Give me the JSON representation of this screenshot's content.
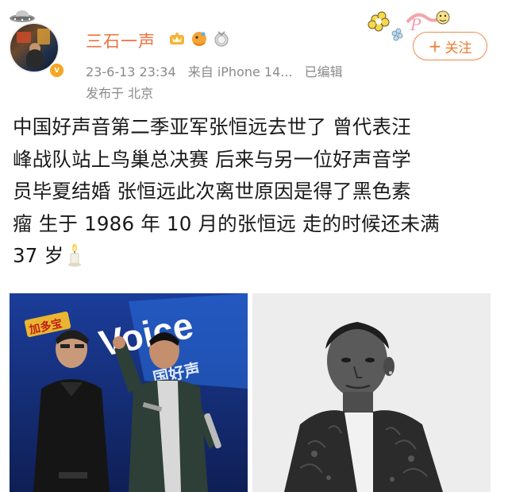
{
  "user": {
    "name": "三石一声",
    "verified_mark": "v"
  },
  "post": {
    "date": "23-6-13 23:34",
    "source": "来自 iPhone 14...",
    "edited": "已编辑",
    "location": "发布于 北京",
    "text_lines": [
      "中国好声音第二季亚军张恒远去世了 曾代表汪",
      "峰战队站上鸟巢总决赛 后来与另一位好声音学",
      "员毕夏结婚 张恒远此次离世原因是得了黑色素",
      "瘤 生于 1986 年 10 月的张恒远 走的时候还未满",
      "37 岁"
    ]
  },
  "follow_button": {
    "plus": "+",
    "label": "关注"
  },
  "images": {
    "left_banner": "加多宝",
    "left_logo": "Voice",
    "left_logo2": "国好声"
  },
  "colors": {
    "username": "#eb7340",
    "follow": "#f07a2e",
    "meta": "#8a8a8a",
    "text": "#1a1a1a"
  },
  "icons": [
    "ufo-icon",
    "crown-badge-icon",
    "fish-badge-icon",
    "medal-badge-icon",
    "candle-icon",
    "verified-icon"
  ]
}
